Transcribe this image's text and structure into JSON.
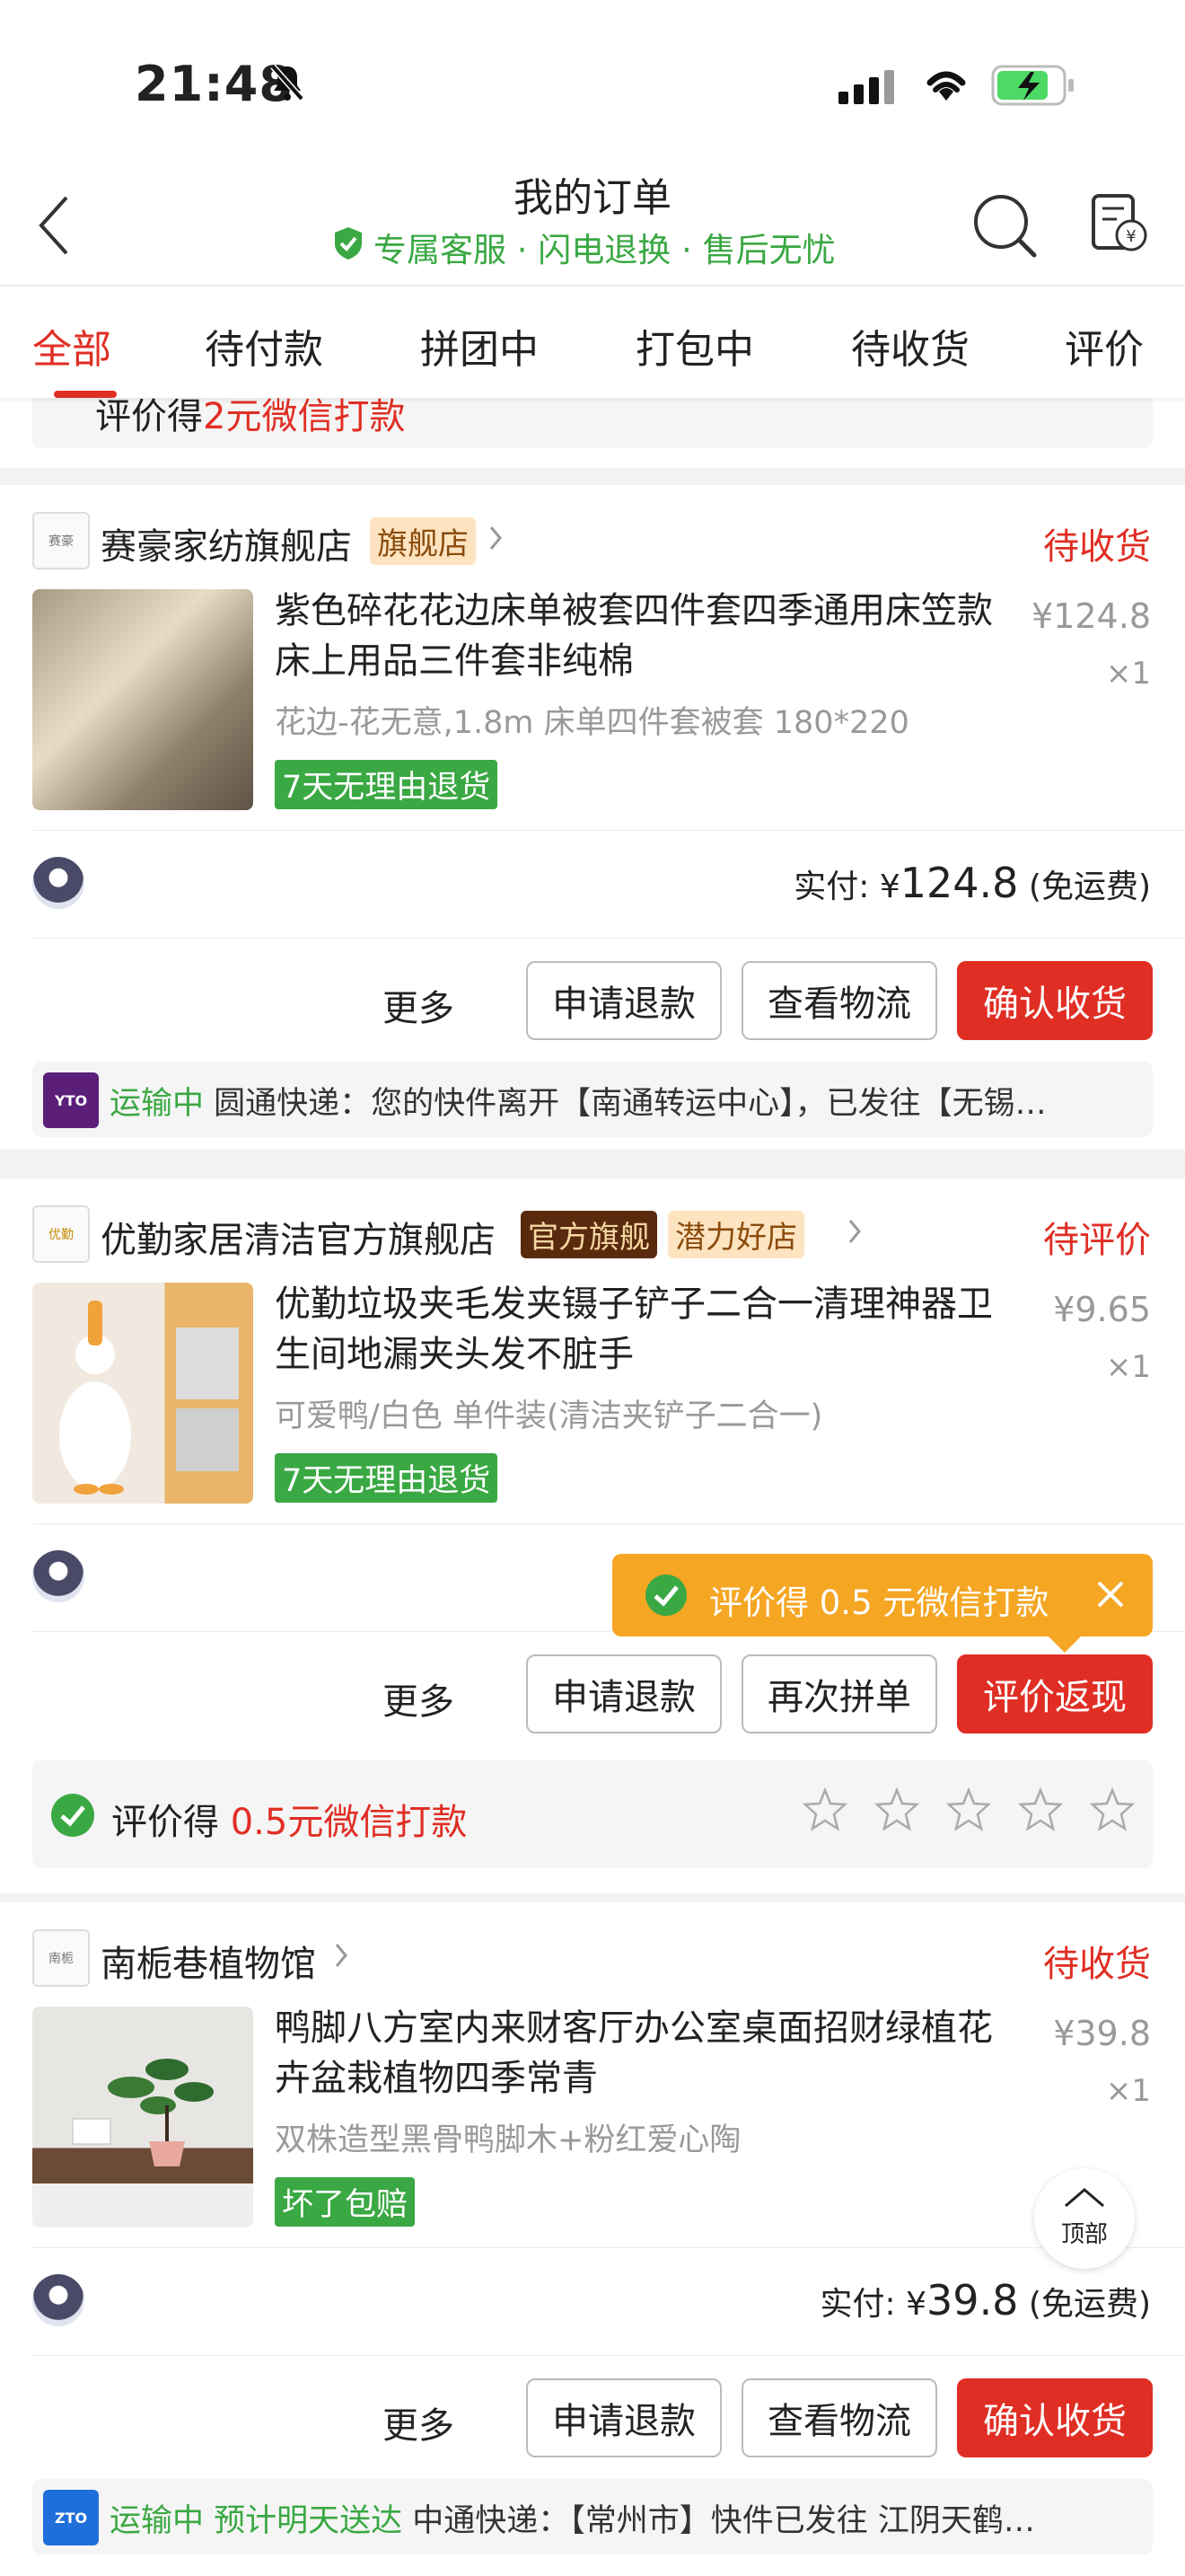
{
  "status_bar": {
    "time": "21:48"
  },
  "header": {
    "title": "我的订单",
    "subtitle": "专属客服 · 闪电退换 · 售后无忧"
  },
  "tabs": [
    "全部",
    "待付款",
    "拼团中",
    "打包中",
    "待收货",
    "评价"
  ],
  "top_partial": {
    "review_text": "评价得",
    "review_amount": "2元微信打款"
  },
  "orders": [
    {
      "store": "赛豪家纺旗舰店",
      "store_tag": "旗舰店",
      "status": "待收货",
      "title": "紫色碎花花边床单被套四件套四季通用床笠款床上用品三件套非纯棉",
      "spec": "花边-花无意,1.8m 床单四件套被套 180*220",
      "price": "¥124.8",
      "qty": "×1",
      "badge": "7天无理由退货",
      "paid_label": "实付:",
      "paid_currency": "¥",
      "paid_amount": "124.8",
      "paid_note": "(免运费)",
      "more": "更多",
      "btn1": "申请退款",
      "btn2": "查看物流",
      "btn3": "确认收货",
      "logistics_status": "运输中",
      "logistics_text": "圆通快递：您的快件离开【南通转运中心】，已发往【无锡…",
      "logistics_icon": "YTO"
    },
    {
      "store": "优勤家居清洁官方旗舰店",
      "store_tag": "官方旗舰",
      "store_tag2": "潜力好店",
      "status": "待评价",
      "title": "优勤垃圾夹毛发夹镊子铲子二合一清理神器卫生间地漏夹头发不脏手",
      "spec": "可爱鸭/白色 单件装(清洁夹铲子二合一)",
      "price": "¥9.65",
      "qty": "×1",
      "badge": "7天无理由退货",
      "more": "更多",
      "btn1": "申请退款",
      "btn2": "再次拼单",
      "btn3": "评价返现",
      "tooltip": "评价得 0.5 元微信打款",
      "review_prefix": "评价得",
      "review_amount": "0.5元微信打款"
    },
    {
      "store": "南栀巷植物馆",
      "status": "待收货",
      "title": "鸭脚八方室内来财客厅办公室桌面招财绿植花卉盆栽植物四季常青",
      "spec": "双株造型黑骨鸭脚木+粉红爱心陶",
      "price": "¥39.8",
      "qty": "×1",
      "badge": "坏了包赔",
      "paid_label": "实付:",
      "paid_currency": "¥",
      "paid_amount": "39.8",
      "paid_note": "(免运费)",
      "more": "更多",
      "btn1": "申请退款",
      "btn2": "查看物流",
      "btn3": "确认收货",
      "logistics_status": "运输中 预计明天送达",
      "logistics_text": "中通快递：【常州市】快件已发往 江阴天鹤…",
      "logistics_icon": "ZTO"
    }
  ],
  "to_top": "顶部",
  "colors": {
    "accent": "#e02e24",
    "green": "#3aa843",
    "tooltip": "#f5a623"
  }
}
